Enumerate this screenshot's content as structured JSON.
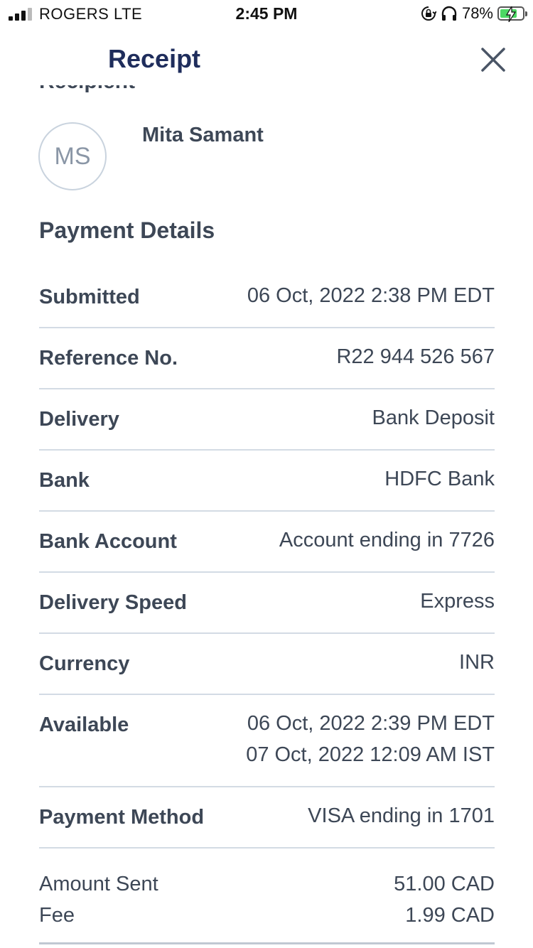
{
  "status_bar": {
    "carrier": "ROGERS  LTE",
    "time": "2:45 PM",
    "battery_percent": "78%",
    "battery_level": 0.78,
    "battery_color": "#4cd964"
  },
  "header": {
    "title": "Receipt",
    "title_color": "#1f2d5c",
    "partial_heading": "Recipient",
    "close_icon": "close-icon"
  },
  "recipient": {
    "initials": "MS",
    "name": "Mita Samant"
  },
  "payment_details": {
    "title": "Payment Details",
    "rows": [
      {
        "label": "Submitted",
        "value": "06 Oct, 2022 2:38 PM EDT"
      },
      {
        "label": "Reference No.",
        "value": "R22 944 526 567"
      },
      {
        "label": "Delivery",
        "value": "Bank Deposit"
      },
      {
        "label": "Bank",
        "value": "HDFC Bank"
      },
      {
        "label": "Bank Account",
        "value": "Account ending in 7726"
      },
      {
        "label": "Delivery Speed",
        "value": "Express"
      },
      {
        "label": "Currency",
        "value": "INR"
      },
      {
        "label": "Available",
        "value_line1": "06 Oct, 2022 2:39 PM EDT",
        "value_line2": "07 Oct, 2022 12:09 AM IST"
      },
      {
        "label": "Payment Method",
        "value": "VISA ending in 1701"
      }
    ],
    "amounts": [
      {
        "label": "Amount Sent",
        "value": "51.00 CAD"
      },
      {
        "label": "Fee",
        "value": "1.99 CAD"
      }
    ]
  }
}
